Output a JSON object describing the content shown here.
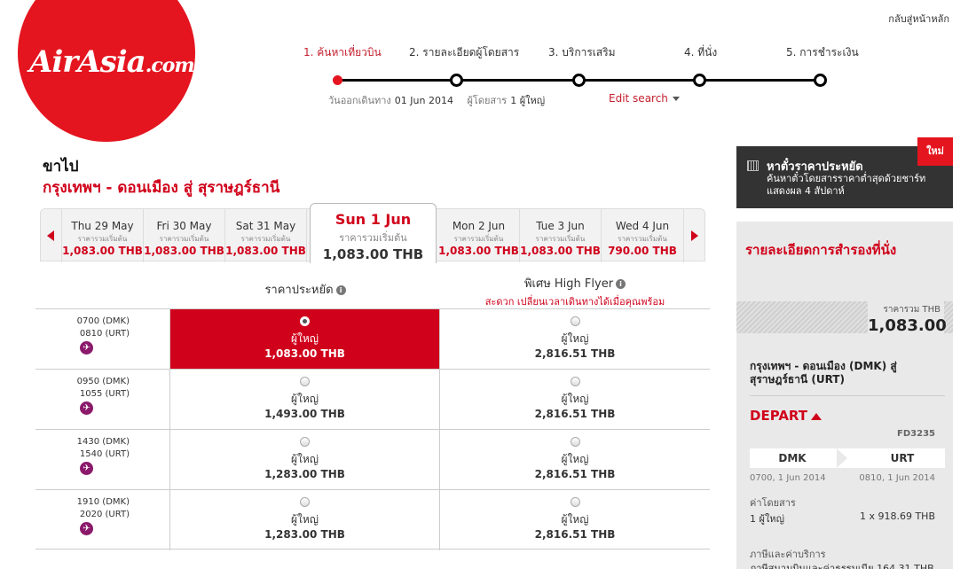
{
  "logo": {
    "text": "AirAsia",
    "suffix": ".com"
  },
  "header": {
    "home_link": "กลับสู่หน้าหลัก"
  },
  "steps": [
    {
      "label": "1. ค้นหาเที่ยวบิน",
      "active": true
    },
    {
      "label": "2. รายละเอียดผู้โดยสาร",
      "active": false
    },
    {
      "label": "3. บริการเสริม",
      "active": false
    },
    {
      "label": "4. ที่นั่ง",
      "active": false
    },
    {
      "label": "5. การชำระเงิน",
      "active": false
    }
  ],
  "search_meta": {
    "depart_label": "วันออกเดินทาง",
    "depart_value": "01 Jun 2014",
    "pax_label": "ผู้โดยสาร",
    "pax_value": "1 ผู้ใหญ่",
    "edit_label": "Edit search"
  },
  "journey": {
    "direction": "ขาไป",
    "route": "กรุงเทพฯ - ดอนเมือง  สู่  สุราษฎร์ธานี"
  },
  "date_tabs": [
    {
      "date": "Thu 29 May",
      "sub": "ราคารวมเริ่มต้น",
      "price": "1,083.00 THB",
      "selected": false
    },
    {
      "date": "Fri 30 May",
      "sub": "ราคารวมเริ่มต้น",
      "price": "1,083.00 THB",
      "selected": false
    },
    {
      "date": "Sat 31 May",
      "sub": "ราคารวมเริ่มต้น",
      "price": "1,083.00 THB",
      "selected": false
    },
    {
      "date": "Sun 1 Jun",
      "sub": "ราคารวมเริ่มต้น",
      "price": "1,083.00 THB",
      "selected": true
    },
    {
      "date": "Mon 2 Jun",
      "sub": "ราคารวมเริ่มต้น",
      "price": "1,083.00 THB",
      "selected": false
    },
    {
      "date": "Tue 3 Jun",
      "sub": "ราคารวมเริ่มต้น",
      "price": "1,083.00 THB",
      "selected": false
    },
    {
      "date": "Wed 4 Jun",
      "sub": "ราคารวมเริ่มต้น",
      "price": "790.00 THB",
      "selected": false
    }
  ],
  "fare_columns": {
    "economy": {
      "title": "ราคาประหยัด"
    },
    "high_flyer": {
      "title": "พิเศษ High Flyer",
      "subtitle": "สะดวก เปลี่ยนเวลาเดินทางได้เมื่อคุณพร้อม"
    }
  },
  "flights": [
    {
      "dep": "0700  (DMK)",
      "arr": "0810  (URT)",
      "eco_pax": "ผู้ใหญ่",
      "eco_price": "1,083.00 THB",
      "hf_pax": "ผู้ใหญ่",
      "hf_price": "2,816.51 THB",
      "selected": true
    },
    {
      "dep": "0950  (DMK)",
      "arr": "1055  (URT)",
      "eco_pax": "ผู้ใหญ่",
      "eco_price": "1,493.00 THB",
      "hf_pax": "ผู้ใหญ่",
      "hf_price": "2,816.51 THB",
      "selected": false
    },
    {
      "dep": "1430  (DMK)",
      "arr": "1540  (URT)",
      "eco_pax": "ผู้ใหญ่",
      "eco_price": "1,283.00 THB",
      "hf_pax": "ผู้ใหญ่",
      "hf_price": "2,816.51 THB",
      "selected": false
    },
    {
      "dep": "1910  (DMK)",
      "arr": "2020  (URT)",
      "eco_pax": "ผู้ใหญ่",
      "eco_price": "1,283.00 THB",
      "hf_pax": "ผู้ใหญ่",
      "hf_price": "2,816.51 THB",
      "selected": false
    }
  ],
  "promo": {
    "title": "หาตั๋วราคาประหยัด",
    "desc": "ค้นหาตั๋วโดยสารราคาต่ำสุดด้วยชาร์ท แสดงผล 4 สัปดาห์",
    "badge": "ใหม่"
  },
  "booking": {
    "heading": "รายละเอียดการสำรองที่นั่ง",
    "total_label": "ราคารวม THB",
    "total_value": "1,083.00",
    "route": "กรุงเทพฯ - ดอนเมือง (DMK) สู่ สุราษฎร์ธานี (URT)",
    "depart_label": "DEPART",
    "flight_no": "FD3235",
    "from": "DMK",
    "to": "URT",
    "from_time": "0700, 1 Jun 2014",
    "to_time": "0810, 1 Jun 2014",
    "fare_label": "ค่าโดยสาร",
    "fare_pax": "1 ผู้ใหญ่",
    "fare_calc": "1 x 918.69 THB",
    "tax_label": "ภาษีและค่าบริการ",
    "tax_row": "ภาษีสนามบินและค่าธรรมเนีย  164.31 THB"
  },
  "colors": {
    "brand_red": "#e4151f",
    "text_red": "#d0021b",
    "plane_icon": "#8b1a6b",
    "panel_gray": "#e9e9e9",
    "promo_dark": "#333333"
  }
}
